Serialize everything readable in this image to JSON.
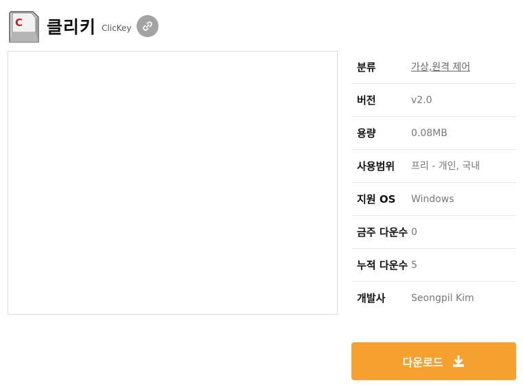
{
  "app": {
    "title": "클리키",
    "subtitle": "ClicKey",
    "icon": "keycap-c-icon",
    "link_icon": "link-icon"
  },
  "info": [
    {
      "label": "분류",
      "value": "가상,원격 제어"
    },
    {
      "label": "버전",
      "value": "v2.0"
    },
    {
      "label": "용량",
      "value": "0.08MB"
    },
    {
      "label": "사용범위",
      "value": "프리 - 개인, 국내"
    },
    {
      "label": "지원 OS",
      "value": "Windows"
    },
    {
      "label": "금주 다운수",
      "value": "0"
    },
    {
      "label": "누적 다운수",
      "value": "5"
    },
    {
      "label": "개발사",
      "value": "Seongpil Kim"
    }
  ],
  "download": {
    "label": "다운로드",
    "icon": "download-icon"
  },
  "colors": {
    "accent": "#f6a02f",
    "link_button": "#a3a3a3"
  }
}
